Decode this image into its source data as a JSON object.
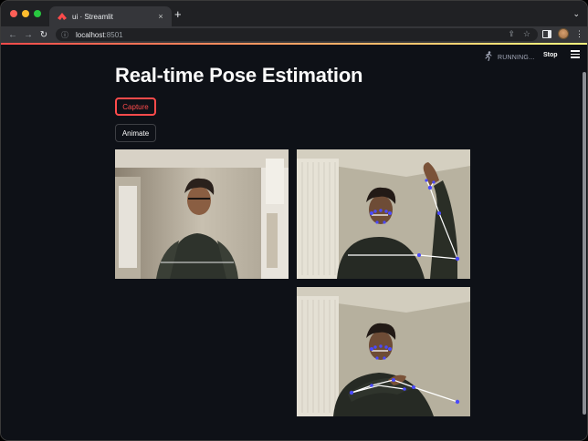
{
  "browser": {
    "tab_title": "ui · Streamlit",
    "url_host": "localhost",
    "url_port": ":8501",
    "close_glyph": "×",
    "new_tab_glyph": "+",
    "tab_search_glyph": "⌄"
  },
  "header": {
    "status": "RUNNING...",
    "stop_label": "Stop"
  },
  "main": {
    "title": "Real-time Pose Estimation",
    "capture_label": "Capture",
    "animate_label": "Animate"
  },
  "images": [
    {
      "name": "webcam-frame",
      "pose_overlay": false
    },
    {
      "name": "pose-frame-raised-arm",
      "pose_overlay": true
    },
    {
      "name": "pose-frame-crossed-arms",
      "pose_overlay": true
    }
  ],
  "colors": {
    "accent": "#ff4b4b",
    "background": "#0e1117",
    "pose_points": "#4a4aff",
    "pose_lines": "#ffffff"
  }
}
